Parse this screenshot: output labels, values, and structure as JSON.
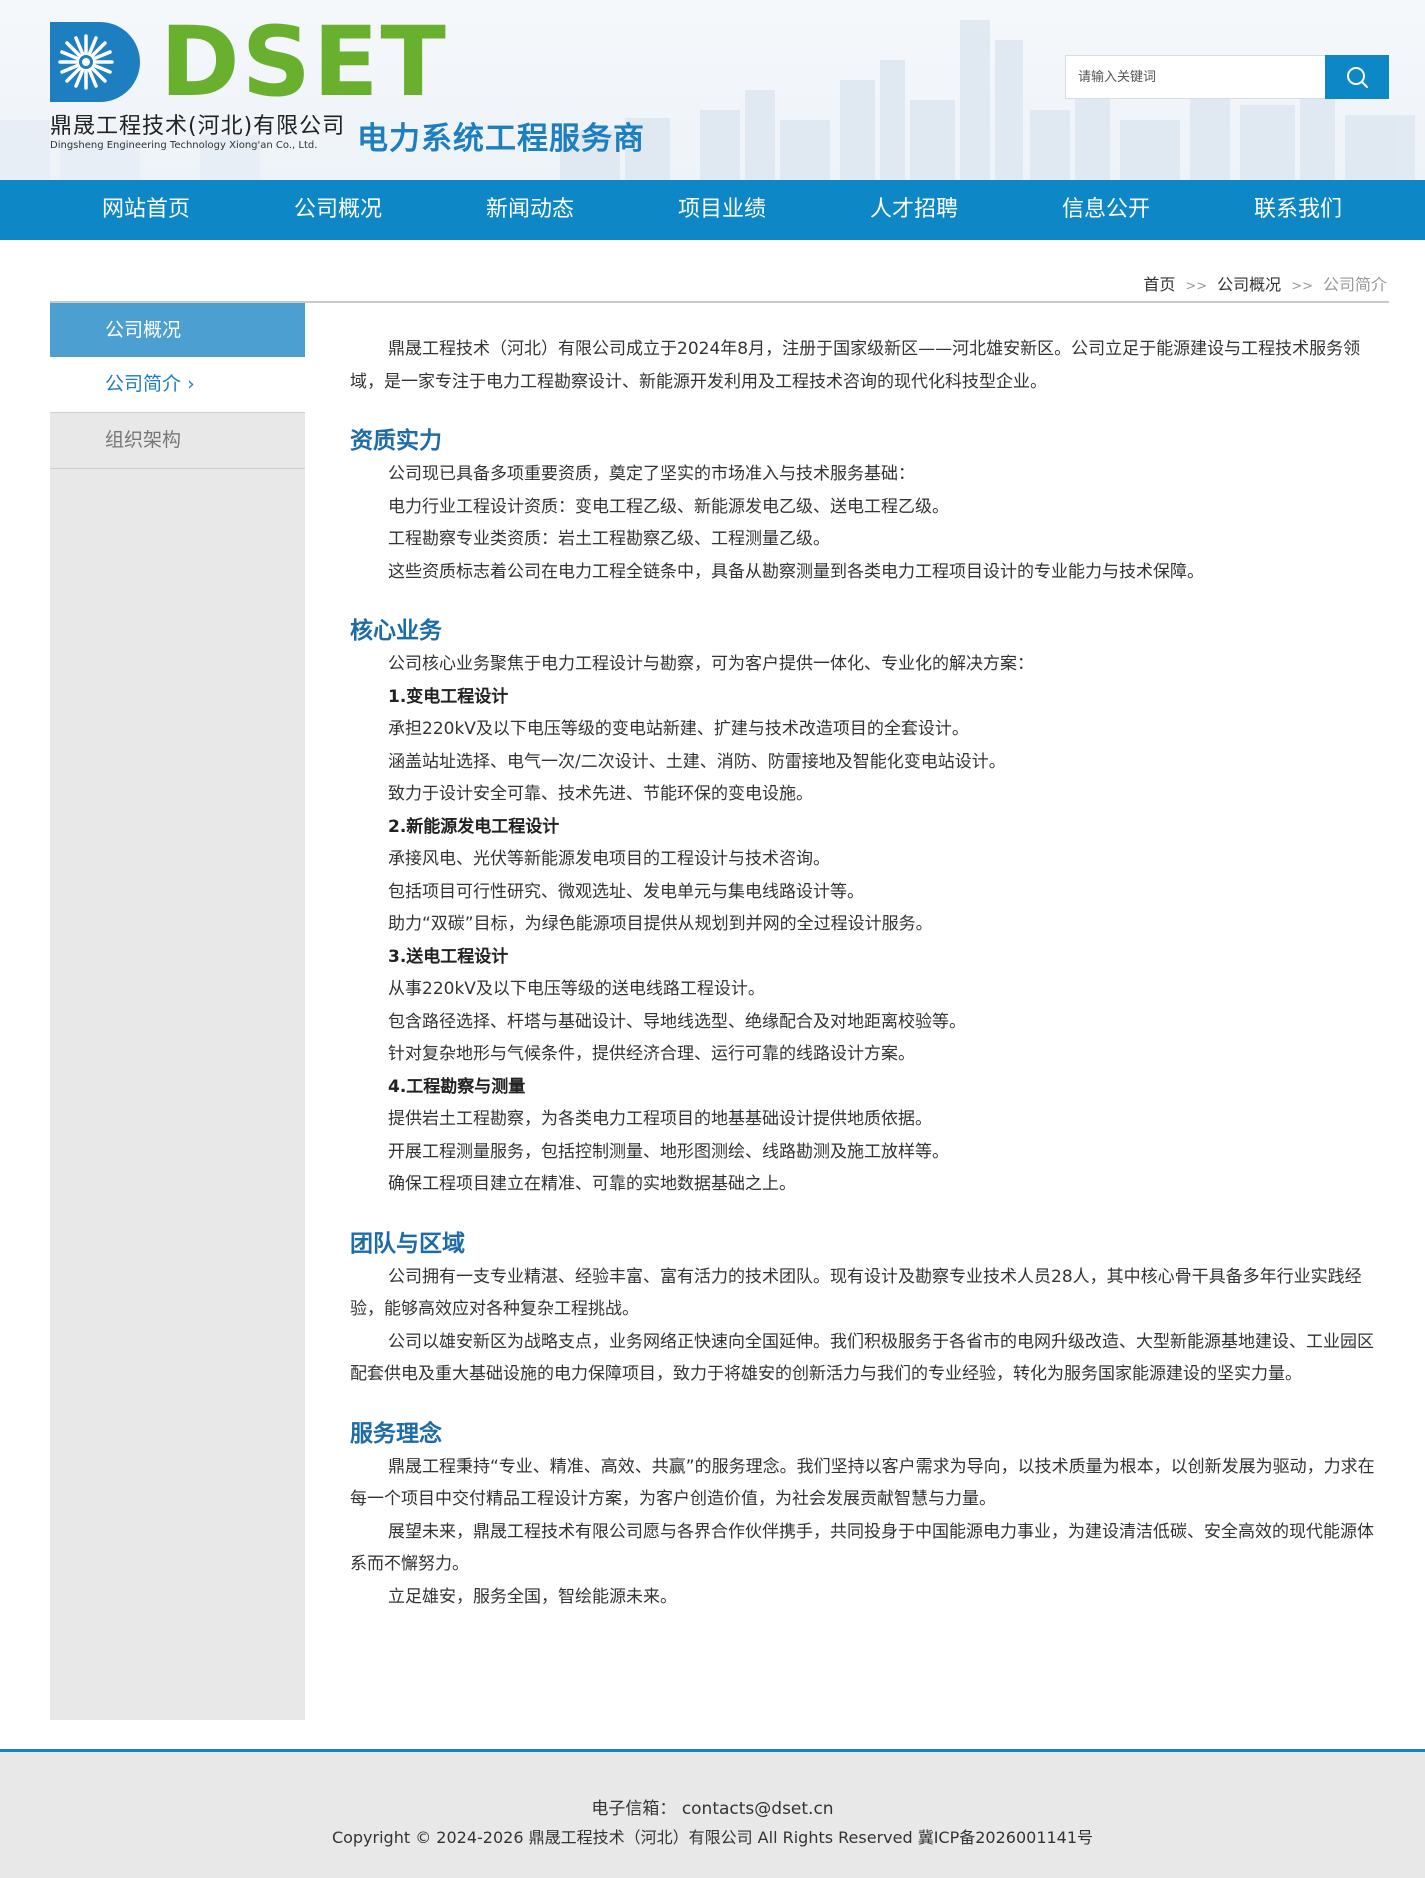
{
  "brand": {
    "logo_text": "DSET",
    "company_cn": "鼎晟工程技术(河北)有限公司",
    "company_en": "Dingsheng Engineering Technology Xiong'an Co., Ltd.",
    "slogan": "电力系统工程服务商",
    "logo_colors": {
      "d": "#1d7ec0",
      "set": "#6ab02f"
    }
  },
  "search": {
    "placeholder": "请输入关键词",
    "value": "",
    "icon": "search-icon"
  },
  "nav": {
    "items": [
      "网站首页",
      "公司概况",
      "新闻动态",
      "项目业绩",
      "人才招聘",
      "信息公开",
      "联系我们"
    ]
  },
  "breadcrumb": {
    "home": "首页",
    "sep": ">>",
    "parent": "公司概况",
    "current": "公司简介"
  },
  "sidebar": {
    "title": "公司概况",
    "items": [
      {
        "label": "公司简介",
        "chevron": "›"
      },
      {
        "label": "组织架构"
      }
    ]
  },
  "content": {
    "intro": "鼎晟工程技术（河北）有限公司成立于2024年8月，注册于国家级新区——河北雄安新区。公司立足于能源建设与工程技术服务领域，是一家专注于电力工程勘察设计、新能源开发利用及工程技术咨询的现代化科技型企业。",
    "sections": [
      {
        "title": "资质实力",
        "paras": [
          "公司现已具备多项重要资质，奠定了坚实的市场准入与技术服务基础：",
          "电力行业工程设计资质：变电工程乙级、新能源发电乙级、送电工程乙级。",
          "工程勘察专业类资质：岩土工程勘察乙级、工程测量乙级。",
          "这些资质标志着公司在电力工程全链条中，具备从勘察测量到各类电力工程项目设计的专业能力与技术保障。"
        ]
      },
      {
        "title": "核心业务",
        "intro": "公司核心业务聚焦于电力工程设计与勘察，可为客户提供一体化、专业化的解决方案：",
        "subs": [
          {
            "title": "1.变电工程设计",
            "lines": [
              "承担220kV及以下电压等级的变电站新建、扩建与技术改造项目的全套设计。",
              "涵盖站址选择、电气一次/二次设计、土建、消防、防雷接地及智能化变电站设计。",
              "致力于设计安全可靠、技术先进、节能环保的变电设施。"
            ]
          },
          {
            "title": "2.新能源发电工程设计",
            "lines": [
              "承接风电、光伏等新能源发电项目的工程设计与技术咨询。",
              "包括项目可行性研究、微观选址、发电单元与集电线路设计等。",
              "助力“双碳”目标，为绿色能源项目提供从规划到并网的全过程设计服务。"
            ]
          },
          {
            "title": "3.送电工程设计",
            "lines": [
              "从事220kV及以下电压等级的送电线路工程设计。",
              "包含路径选择、杆塔与基础设计、导地线选型、绝缘配合及对地距离校验等。",
              "针对复杂地形与气候条件，提供经济合理、运行可靠的线路设计方案。"
            ]
          },
          {
            "title": "4.工程勘察与测量",
            "lines": [
              "提供岩土工程勘察，为各类电力工程项目的地基基础设计提供地质依据。",
              "开展工程测量服务，包括控制测量、地形图测绘、线路勘测及施工放样等。",
              "确保工程项目建立在精准、可靠的实地数据基础之上。"
            ]
          }
        ]
      },
      {
        "title": "团队与区域",
        "paras": [
          "公司拥有一支专业精湛、经验丰富、富有活力的技术团队。现有设计及勘察专业技术人员28人，其中核心骨干具备多年行业实践经验，能够高效应对各种复杂工程挑战。",
          "公司以雄安新区为战略支点，业务网络正快速向全国延伸。我们积极服务于各省市的电网升级改造、大型新能源基地建设、工业园区配套供电及重大基础设施的电力保障项目，致力于将雄安的创新活力与我们的专业经验，转化为服务国家能源建设的坚实力量。"
        ]
      },
      {
        "title": "服务理念",
        "paras": [
          "鼎晟工程秉持“专业、精准、高效、共赢”的服务理念。我们坚持以客户需求为导向，以技术质量为根本，以创新发展为驱动，力求在每一个项目中交付精品工程设计方案，为客户创造价值，为社会发展贡献智慧与力量。",
          "展望未来，鼎晟工程技术有限公司愿与各界合作伙伴携手，共同投身于中国能源电力事业，为建设清洁低碳、安全高效的现代能源体系而不懈努力。",
          "立足雄安，服务全国，智绘能源未来。"
        ]
      }
    ]
  },
  "footer": {
    "email_label": "电子信箱：",
    "email": "contacts@dset.cn",
    "copyright": "Copyright © 2024-2026 鼎晟工程技术（河北）有限公司 All Rights Reserved 冀ICP备2026001141号"
  },
  "colors": {
    "primary": "#0d87c5",
    "sidebar_head": "#4b9fd1",
    "heading": "#1d6ca8",
    "green": "#6ab02f"
  }
}
